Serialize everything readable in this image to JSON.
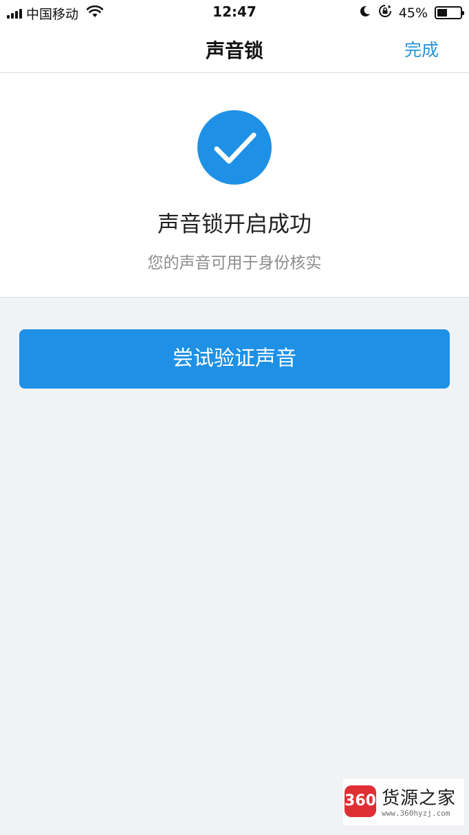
{
  "status_bar": {
    "carrier": "中国移动",
    "time": "12:47",
    "battery_percent": "45%",
    "battery_level": 0.45,
    "icons": [
      "signal-icon",
      "wifi-icon",
      "moon-icon",
      "rotation-lock-icon",
      "battery-icon"
    ]
  },
  "nav": {
    "title": "声音锁",
    "done_label": "完成"
  },
  "result": {
    "icon": "checkmark-icon",
    "title": "声音锁开启成功",
    "subtitle": "您的声音可用于身份核实"
  },
  "actions": {
    "verify_label": "尝试验证声音"
  },
  "watermark": {
    "logo_text": "360",
    "name": "货源之家",
    "url": "www.360hyzj.com"
  },
  "colors": {
    "accent": "#1e91e6",
    "link": "#2494dc",
    "background": "#f1f2f6"
  }
}
